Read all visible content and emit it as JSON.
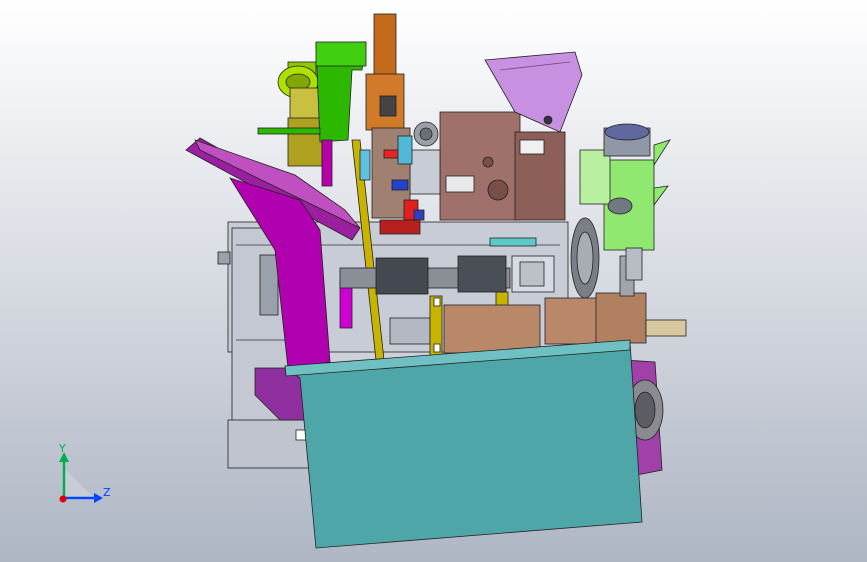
{
  "viewport": {
    "background_top": "#ffffff",
    "background_bottom": "#aeb6c4"
  },
  "triad": {
    "y_label": "Y",
    "z_label": "Z",
    "y_color": "#00b050",
    "z_color": "#0044ff",
    "x_color": "#e00000"
  },
  "colors": {
    "frame_gray": "#c8ccd6",
    "magenta": "#b000b0",
    "teal": "#4ea6a8",
    "brown": "#a0706a",
    "green": "#2db800",
    "orange": "#c46a1a",
    "yellow": "#c8b400",
    "lavender": "#c890e0",
    "light_green": "#90e870",
    "tan": "#b88868",
    "dark_gray": "#555a66",
    "purple": "#9030a0"
  }
}
